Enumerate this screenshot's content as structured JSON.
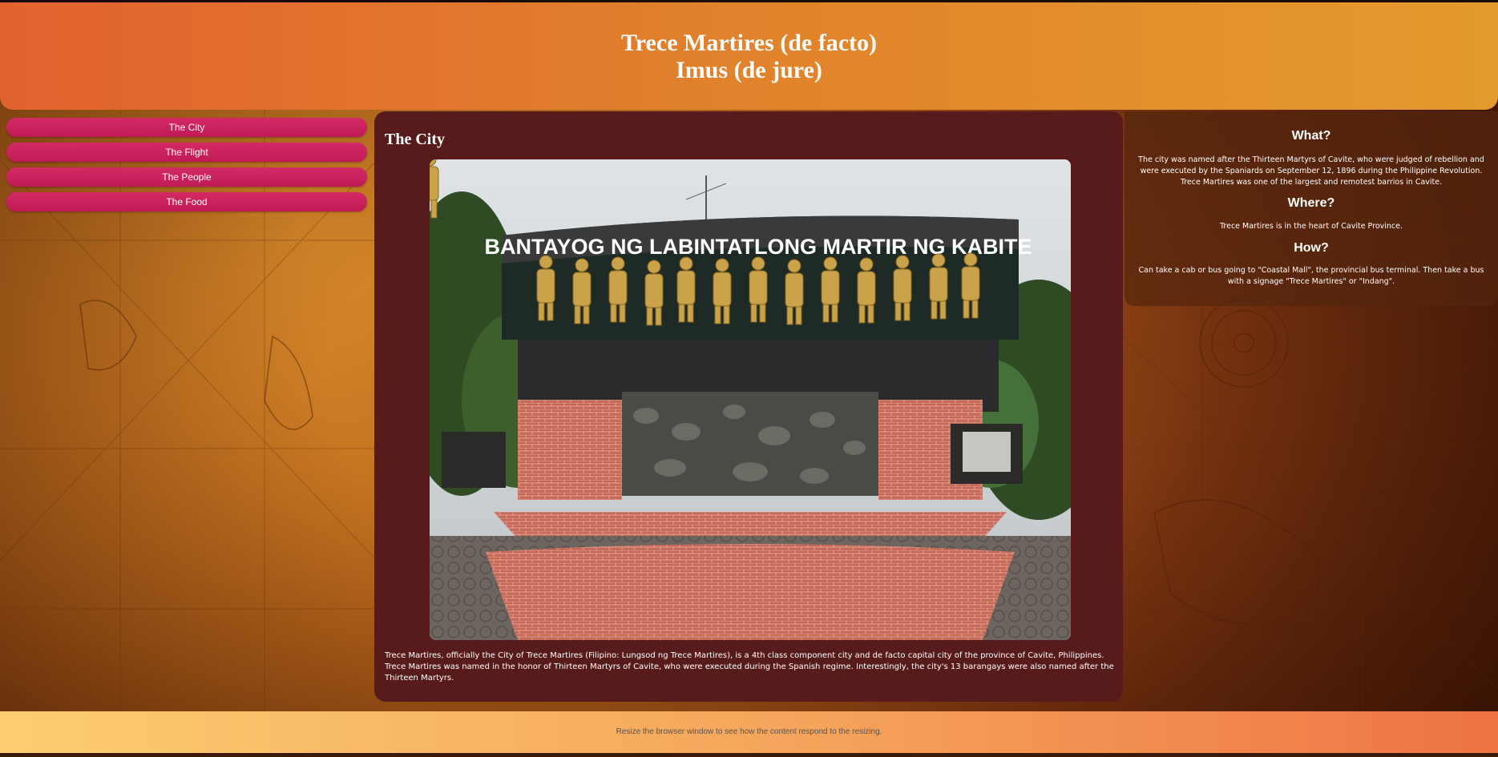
{
  "header": {
    "title_line1": "Trece Martires (de facto)",
    "title_line2": "Imus (de jure)"
  },
  "nav": {
    "items": [
      {
        "label": "The City"
      },
      {
        "label": "The Flight"
      },
      {
        "label": "The People"
      },
      {
        "label": "The Food"
      }
    ]
  },
  "main": {
    "heading": "The City",
    "photo": {
      "sign_text": "BANTAYOG NG LABINTATLONG MARTIR NG KABITE"
    },
    "caption": "Trece Martires, officially the City of Trece Martires (Filipino: Lungsod ng Trece Martires), is a 4th class component city and de facto capital city of the province of Cavite, Philippines. Trece Martires was named in the honor of Thirteen Martyrs of Cavite, who were executed during the Spanish regime. Interestingly, the city's 13 barangays were also named after the Thirteen Martyrs."
  },
  "aside": {
    "what_heading": "What?",
    "what_text": "The city was named after the Thirteen Martyrs of Cavite, who were judged of rebellion and were executed by the Spaniards on September 12, 1896 during the Philippine Revolution. Trece Martires was one of the largest and remotest barrios in Cavite.",
    "where_heading": "Where?",
    "where_text": "Trece Martires is in the heart of Cavite Province.",
    "how_heading": "How?",
    "how_text": "Can take a cab or bus going to \"Coastal Mall\", the provincial bus terminal. Then take a bus with a signage \"Trece Martires\" or \"Indang\"."
  },
  "footer": {
    "text": "Resize the browser window to see how the content respond to the resizing."
  },
  "colors": {
    "header_start": "#e2622e",
    "header_end": "#e49a2c",
    "nav_button": "#c81d5c",
    "main_panel": "#581b1b",
    "footer_start": "#fccd72",
    "footer_end": "#ee7444"
  }
}
